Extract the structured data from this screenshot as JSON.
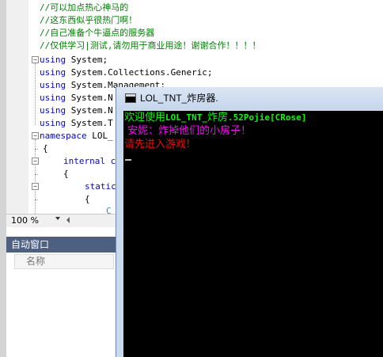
{
  "editor": {
    "comments": [
      "//可以加点热心神马的",
      "//这东西似乎很热门啊！",
      "//自己准备个牛逼点的服务器",
      "//仅供学习|测试,请勿用于商业用途！谢谢合作！！！！"
    ],
    "usings": [
      {
        "kw": "using",
        "ns": " System;"
      },
      {
        "kw": "using",
        "ns": " System.Collections.Generic;"
      },
      {
        "kw": "using",
        "ns": " System.Management;"
      },
      {
        "kw": "using",
        "ns": " System.N"
      },
      {
        "kw": "using",
        "ns": " System.N"
      },
      {
        "kw": "using",
        "ns": " System.T"
      }
    ],
    "namespace_kw": "namespace",
    "namespace_name": " LOL_",
    "brace_open": "{",
    "internal_kw": "internal",
    "internal_rest": " c",
    "brace_open2": "{",
    "static_kw": "static",
    "brace_open3": "{",
    "partial_text": "C"
  },
  "zoom": {
    "value": "100 %"
  },
  "auto_window": {
    "title": "自动窗口",
    "column_name": "名称"
  },
  "console": {
    "title": "LOL_TNT_炸房器.",
    "lines": [
      {
        "prefix": "欢迎使用",
        "mono": "LOL_TNT_",
        "middle": "炸房",
        "mono2": ".52Pojie[CRose]",
        "color": "#00ff00"
      },
      {
        "text": " 安妮：炸掉他们的小房子！",
        "color": "#ff00ff"
      },
      {
        "text": "请先进入游戏!",
        "color": "#ff0000"
      }
    ]
  },
  "colors": {
    "keyword": "#0000ff",
    "comment": "#008000",
    "panel_header": "#4d6082",
    "console_bg": "#000000"
  }
}
